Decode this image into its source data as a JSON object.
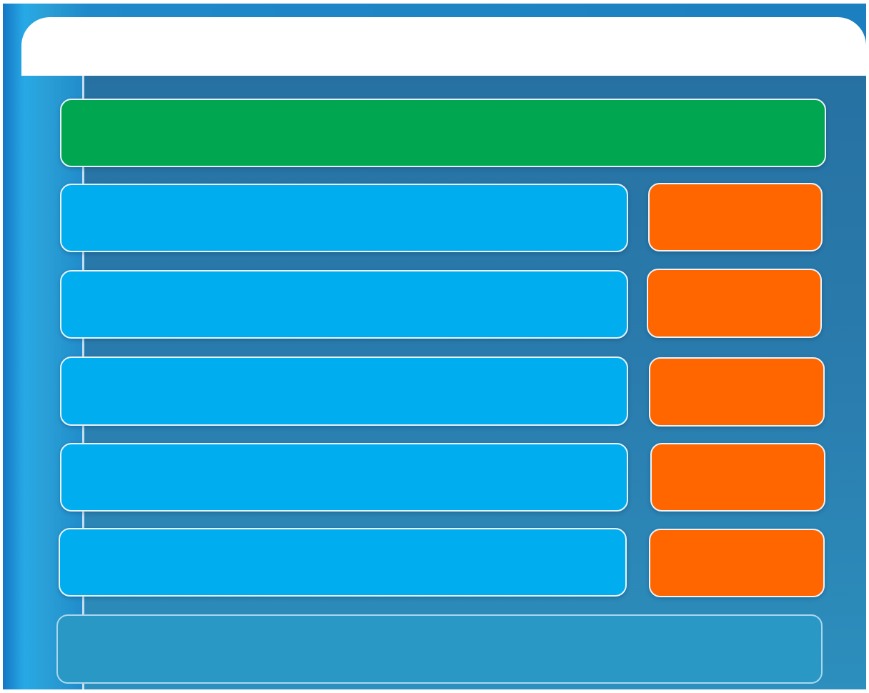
{
  "header": {
    "title": ""
  },
  "question": {
    "text": ""
  },
  "rows": [
    {
      "option_label": "",
      "action_label": ""
    },
    {
      "option_label": "",
      "action_label": ""
    },
    {
      "option_label": "",
      "action_label": ""
    },
    {
      "option_label": "",
      "action_label": ""
    },
    {
      "option_label": "",
      "action_label": ""
    }
  ],
  "footer": {
    "text": ""
  },
  "colors": {
    "background_blue": "#1f89c9",
    "panel_blue": "#2a7cae",
    "question_green": "#00a650",
    "option_blue": "#00adef",
    "action_orange": "#ff6600"
  }
}
